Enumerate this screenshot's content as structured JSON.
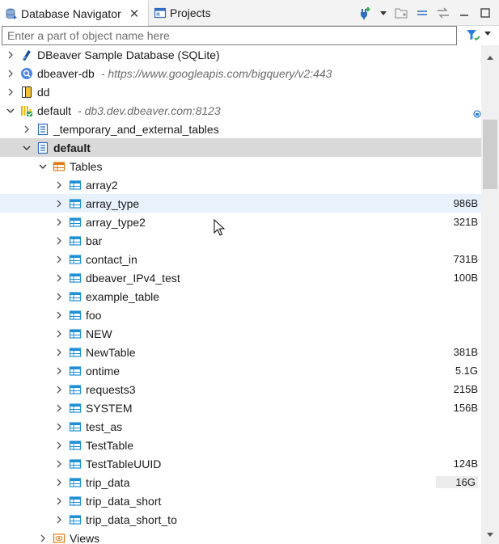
{
  "tabs": [
    {
      "label": "Database Navigator",
      "icon": "database-navigator-icon",
      "active": true
    },
    {
      "label": "Projects",
      "icon": "projects-icon",
      "active": false
    }
  ],
  "filter": {
    "placeholder": "Enter a part of object name here",
    "value": ""
  },
  "tree": [
    {
      "label": "DBeaver Sample Database (SQLite)",
      "sub": "",
      "size": "",
      "icon": "sqlite-icon",
      "twisty": "collapsed",
      "level": 0
    },
    {
      "label": "dbeaver-db",
      "sub": "- https://www.googleapis.com/bigquery/v2:443",
      "size": "",
      "icon": "bigquery-icon",
      "twisty": "collapsed",
      "level": 0
    },
    {
      "label": "dd",
      "sub": "",
      "size": "",
      "icon": "database-yellow-icon",
      "twisty": "collapsed",
      "level": 0
    },
    {
      "label": "default",
      "sub": "- db3.dev.dbeaver.com:8123",
      "size": "",
      "icon": "clickhouse-icon",
      "twisty": "expanded",
      "level": 0
    },
    {
      "label": "_temporary_and_external_tables",
      "sub": "",
      "size": "",
      "icon": "schema-icon",
      "twisty": "collapsed",
      "level": 1
    },
    {
      "label": "default",
      "sub": "",
      "size": "",
      "icon": "schema-icon",
      "twisty": "expanded",
      "level": 1,
      "bold": true,
      "selected": true
    },
    {
      "label": "Tables",
      "sub": "",
      "size": "",
      "icon": "tables-folder-icon",
      "twisty": "expanded",
      "level": 2
    },
    {
      "label": "array2",
      "sub": "",
      "size": "",
      "icon": "table-icon",
      "twisty": "collapsed",
      "level": 3
    },
    {
      "label": "array_type",
      "sub": "",
      "size": "986B",
      "icon": "table-icon",
      "twisty": "collapsed",
      "level": 3,
      "hover": true
    },
    {
      "label": "array_type2",
      "sub": "",
      "size": "321B",
      "icon": "table-icon",
      "twisty": "collapsed",
      "level": 3
    },
    {
      "label": "bar",
      "sub": "",
      "size": "",
      "icon": "table-icon",
      "twisty": "collapsed",
      "level": 3
    },
    {
      "label": "contact_in",
      "sub": "",
      "size": "731B",
      "icon": "table-icon",
      "twisty": "collapsed",
      "level": 3
    },
    {
      "label": "dbeaver_IPv4_test",
      "sub": "",
      "size": "100B",
      "icon": "table-icon",
      "twisty": "collapsed",
      "level": 3
    },
    {
      "label": "example_table",
      "sub": "",
      "size": "",
      "icon": "table-icon",
      "twisty": "collapsed",
      "level": 3
    },
    {
      "label": "foo",
      "sub": "",
      "size": "",
      "icon": "table-icon",
      "twisty": "collapsed",
      "level": 3
    },
    {
      "label": "NEW",
      "sub": "",
      "size": "",
      "icon": "table-icon",
      "twisty": "collapsed",
      "level": 3
    },
    {
      "label": "NewTable",
      "sub": "",
      "size": "381B",
      "icon": "table-icon",
      "twisty": "collapsed",
      "level": 3
    },
    {
      "label": "ontime",
      "sub": "",
      "size": "5.1G",
      "icon": "table-icon",
      "twisty": "collapsed",
      "level": 3
    },
    {
      "label": "requests3",
      "sub": "",
      "size": "215B",
      "icon": "table-icon",
      "twisty": "collapsed",
      "level": 3
    },
    {
      "label": "SYSTEM",
      "sub": "",
      "size": "156B",
      "icon": "table-icon",
      "twisty": "collapsed",
      "level": 3
    },
    {
      "label": "test_as",
      "sub": "",
      "size": "",
      "icon": "table-icon",
      "twisty": "collapsed",
      "level": 3
    },
    {
      "label": "TestTable",
      "sub": "",
      "size": "",
      "icon": "table-icon",
      "twisty": "collapsed",
      "level": 3
    },
    {
      "label": "TestTableUUID",
      "sub": "",
      "size": "124B",
      "icon": "table-icon",
      "twisty": "collapsed",
      "level": 3
    },
    {
      "label": "trip_data",
      "sub": "",
      "size": "16G",
      "icon": "table-icon",
      "twisty": "collapsed",
      "level": 3,
      "size_shaded": true
    },
    {
      "label": "trip_data_short",
      "sub": "",
      "size": "",
      "icon": "table-icon",
      "twisty": "collapsed",
      "level": 3
    },
    {
      "label": "trip_data_short_to",
      "sub": "",
      "size": "",
      "icon": "table-icon",
      "twisty": "collapsed",
      "level": 3
    },
    {
      "label": "Views",
      "sub": "",
      "size": "",
      "icon": "views-icon",
      "twisty": "collapsed",
      "level": 2
    }
  ],
  "colors": {
    "accent": "#1a73c9",
    "table_icon": "#1e90d6",
    "selection": "#d9d9d9",
    "hover": "#e8f2fc"
  }
}
